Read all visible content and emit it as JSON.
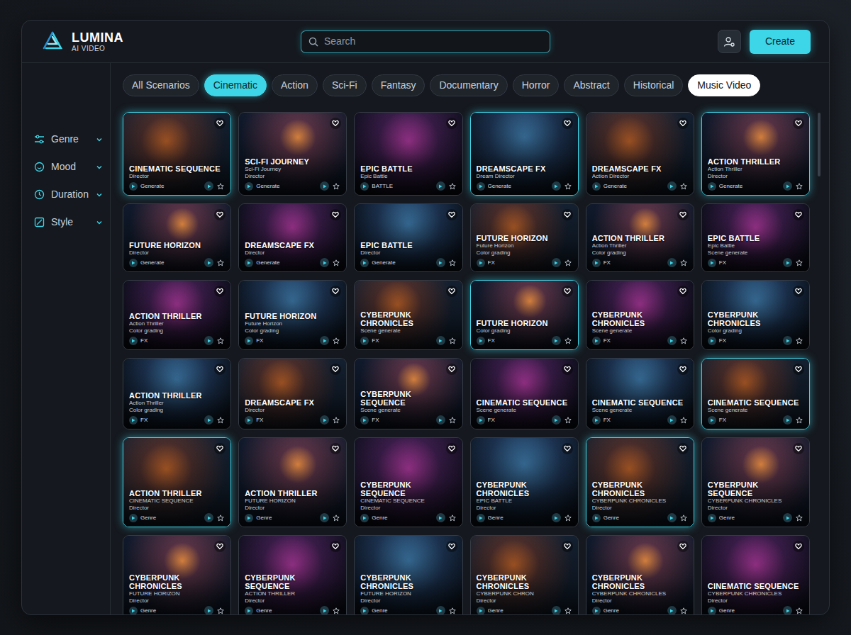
{
  "app": {
    "name": "LUMINA",
    "subtitle": "AI VIDEO"
  },
  "search": {
    "placeholder": "Search"
  },
  "header": {
    "create": "Create"
  },
  "sidebar": {
    "items": [
      {
        "label": "Genre",
        "expanded": false
      },
      {
        "label": "Mood",
        "expanded": false
      },
      {
        "label": "Duration",
        "expanded": false
      },
      {
        "label": "Style",
        "expanded": false
      }
    ]
  },
  "filters": [
    {
      "label": "All Scenarios",
      "selected": false,
      "highlighted": false
    },
    {
      "label": "Cinematic",
      "selected": true,
      "highlighted": false
    },
    {
      "label": "Action",
      "selected": false,
      "highlighted": false
    },
    {
      "label": "Sci-Fi",
      "selected": false,
      "highlighted": false
    },
    {
      "label": "Fantasy",
      "selected": false,
      "highlighted": false
    },
    {
      "label": "Documentary",
      "selected": false,
      "highlighted": false
    },
    {
      "label": "Horror",
      "selected": false,
      "highlighted": false
    },
    {
      "label": "Abstract",
      "selected": false,
      "highlighted": false
    },
    {
      "label": "Historical",
      "selected": false,
      "highlighted": false
    },
    {
      "label": "Music Video",
      "selected": false,
      "highlighted": true
    }
  ],
  "cards": [
    {
      "title": "CINEMATIC SEQUENCE",
      "lines": [
        "Director",
        "Generate"
      ],
      "highlighted": true
    },
    {
      "title": "SCI-FI JOURNEY",
      "lines": [
        "Sci-Fi Journey",
        "Director",
        "Generate"
      ],
      "highlighted": false
    },
    {
      "title": "EPIC BATTLE",
      "lines": [
        "Epic Battle",
        "BATTLE"
      ],
      "highlighted": false
    },
    {
      "title": "DREAMSCAPE FX",
      "lines": [
        "Dream Director",
        "Generate"
      ],
      "highlighted": true
    },
    {
      "title": "DREAMSCAPE FX",
      "lines": [
        "Action Director",
        "Generate"
      ],
      "highlighted": false
    },
    {
      "title": "ACTION THRILLER",
      "lines": [
        "Action Thriller",
        "Director",
        "Generate"
      ],
      "highlighted": true
    },
    {
      "title": "FUTURE HORIZON",
      "lines": [
        "Director",
        "Generate"
      ],
      "highlighted": false
    },
    {
      "title": "DREAMSCAPE FX",
      "lines": [
        "Director",
        "Generate"
      ],
      "highlighted": false
    },
    {
      "title": "EPIC BATTLE",
      "lines": [
        "Director",
        "Generate"
      ],
      "highlighted": false
    },
    {
      "title": "FUTURE HORIZON",
      "lines": [
        "Future Horizon",
        "Color grading",
        "FX"
      ],
      "highlighted": false
    },
    {
      "title": "ACTION THRILLER",
      "lines": [
        "Action Thriller",
        "Color grading",
        "FX"
      ],
      "highlighted": false
    },
    {
      "title": "EPIC BATTLE",
      "lines": [
        "Epic Battle",
        "Scene generate",
        "FX"
      ],
      "highlighted": false
    },
    {
      "title": "ACTION THRILLER",
      "lines": [
        "Action Thriller",
        "Color grading",
        "FX"
      ],
      "highlighted": false
    },
    {
      "title": "FUTURE HORIZON",
      "lines": [
        "Future Horizon",
        "Color grading",
        "FX"
      ],
      "highlighted": false
    },
    {
      "title": "CYBERPUNK CHRONICLES",
      "lines": [
        "Scene generate",
        "FX"
      ],
      "highlighted": false
    },
    {
      "title": "FUTURE HORIZON",
      "lines": [
        "Color grading",
        "FX"
      ],
      "highlighted": true
    },
    {
      "title": "CYBERPUNK CHRONICLES",
      "lines": [
        "Scene generate",
        "FX"
      ],
      "highlighted": false
    },
    {
      "title": "CYBERPUNK CHRONICLES",
      "lines": [
        "Color grading",
        "FX"
      ],
      "highlighted": false
    },
    {
      "title": "ACTION THRILLER",
      "lines": [
        "Action Thriller",
        "Color grading",
        "FX"
      ],
      "highlighted": false
    },
    {
      "title": "DREAMSCAPE FX",
      "lines": [
        "Director",
        "FX"
      ],
      "highlighted": false
    },
    {
      "title": "CYBERPUNK SEQUENCE",
      "lines": [
        "Scene generate",
        "FX"
      ],
      "highlighted": false
    },
    {
      "title": "CINEMATIC SEQUENCE",
      "lines": [
        "Scene generate",
        "FX"
      ],
      "highlighted": false
    },
    {
      "title": "CINEMATIC SEQUENCE",
      "lines": [
        "Scene generate",
        "FX"
      ],
      "highlighted": false
    },
    {
      "title": "CINEMATIC SEQUENCE",
      "lines": [
        "Scene generate",
        "FX"
      ],
      "highlighted": true
    },
    {
      "title": "ACTION THRILLER",
      "lines": [
        "CINEMATIC SEQUENCE",
        "Director",
        "Genre"
      ],
      "highlighted": true
    },
    {
      "title": "ACTION THRILLER",
      "lines": [
        "FUTURE HORIZON",
        "Director",
        "Genre"
      ],
      "highlighted": false
    },
    {
      "title": "CYBERPUNK SEQUENCE",
      "lines": [
        "CINEMATIC SEQUENCE",
        "Director",
        "Genre"
      ],
      "highlighted": false
    },
    {
      "title": "CYBERPUNK CHRONICLES",
      "lines": [
        "EPIC BATTLE",
        "Director",
        "Genre"
      ],
      "highlighted": false
    },
    {
      "title": "CYBERPUNK CHRONICLES",
      "lines": [
        "CYBERPUNK CHRONICLES",
        "Director",
        "Genre"
      ],
      "highlighted": true
    },
    {
      "title": "CYBERPUNK SEQUENCE",
      "lines": [
        "CYBERPUNK CHRONICLES",
        "Director",
        "Genre"
      ],
      "highlighted": false
    },
    {
      "title": "CYBERPUNK CHRONICLES",
      "lines": [
        "FUTURE HORIZON",
        "Director",
        "Genre"
      ],
      "highlighted": false
    },
    {
      "title": "CYBERPUNK SEQUENCE",
      "lines": [
        "ACTION THRILLER",
        "Director",
        "Genre"
      ],
      "highlighted": false
    },
    {
      "title": "CYBERPUNK CHRONICLES",
      "lines": [
        "FUTURE HORIZON",
        "Director",
        "Genre"
      ],
      "highlighted": false
    },
    {
      "title": "CYBERPUNK CHRONICLES",
      "lines": [
        "CYBERPUNK CHRON",
        "Director",
        "Genre"
      ],
      "highlighted": false
    },
    {
      "title": "CYBERPUNK CHRONICLES",
      "lines": [
        "CYBERPUNK CHRONICLES",
        "Director",
        "Genre"
      ],
      "highlighted": false
    },
    {
      "title": "CINEMATIC SEQUENCE",
      "lines": [
        "CYBERPUNK CHRONICLES",
        "Director",
        "Genre"
      ],
      "highlighted": false
    }
  ]
}
